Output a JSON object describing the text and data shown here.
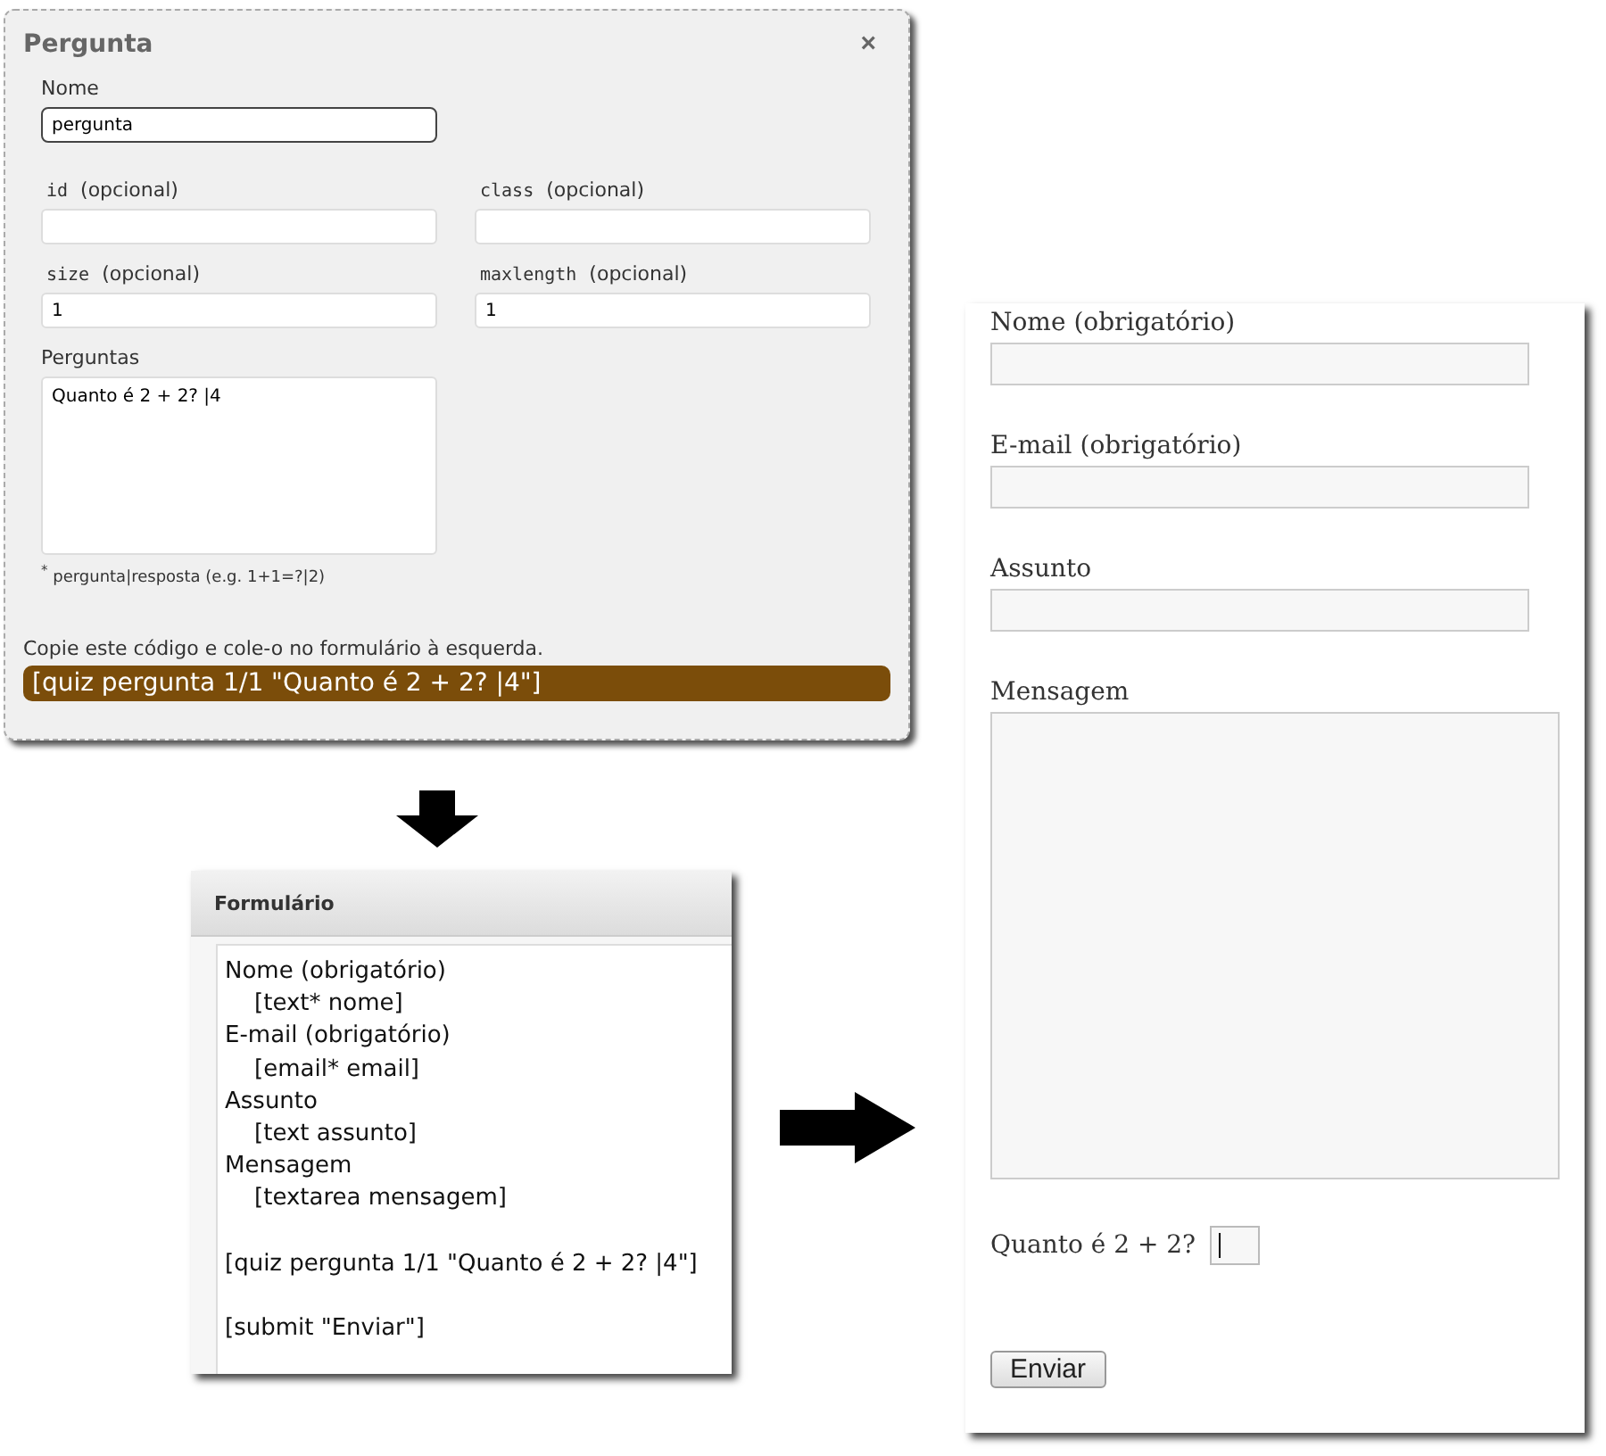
{
  "dialog": {
    "title": "Pergunta",
    "close": "×",
    "name_field": {
      "label": "Nome",
      "value": "pergunta"
    },
    "fields": [
      {
        "name": "id",
        "note": "(opcional)"
      },
      {
        "name": "class",
        "note": "(opcional)"
      },
      {
        "name": "size",
        "note": "(opcional)",
        "value": "1"
      },
      {
        "name": "maxlength",
        "note": "(opcional)",
        "value": "1"
      }
    ],
    "questions": {
      "label": "Perguntas",
      "value": "Quanto é 2 + 2? |4"
    },
    "hint_mark": "*",
    "hint": "pergunta|resposta (e.g. 1+1=?|2)",
    "copy_text": "Copie este código e cole-o no formulário à esquerda.",
    "code": "[quiz pergunta 1/1 \"Quanto é 2 + 2? |4\"]"
  },
  "form_editor": {
    "title": "Formulário",
    "blocks": [
      {
        "lines": [
          "Nome (obrigatório)",
          "    [text* nome]",
          "E-mail (obrigatório)",
          "    [email* email]",
          "Assunto",
          "    [text assunto]",
          "Mensagem",
          "    [textarea mensagem]"
        ]
      },
      {
        "lines": [
          "[quiz pergunta 1/1 \"Quanto é 2 + 2? |4\"]"
        ]
      },
      {
        "lines": [
          "[submit \"Enviar\"]"
        ]
      }
    ]
  },
  "preview": {
    "fields": [
      {
        "kind": "text",
        "label": "Nome (obrigatório)"
      },
      {
        "kind": "text",
        "label": "E-mail (obrigatório)"
      },
      {
        "kind": "text",
        "label": "Assunto"
      },
      {
        "kind": "textarea",
        "label": "Mensagem"
      }
    ],
    "quiz": {
      "question": "Quanto é 2 + 2?",
      "focused": true
    },
    "submit": "Enviar"
  }
}
